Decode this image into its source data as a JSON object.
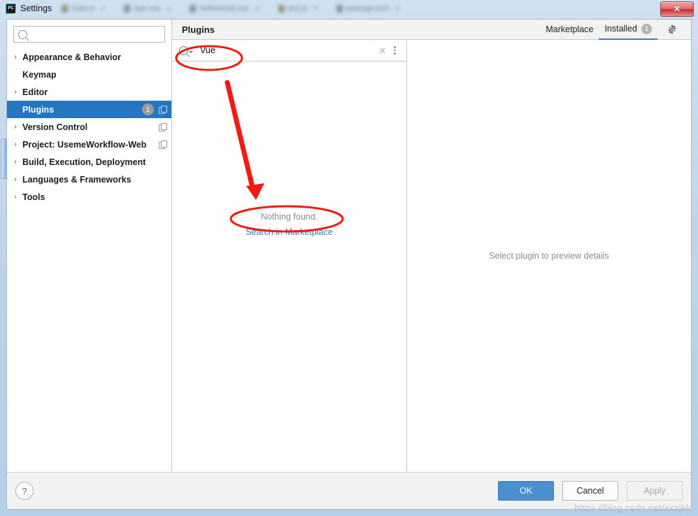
{
  "window": {
    "title": "Settings",
    "icon": "pycharm-logo-icon",
    "close_label": "✕",
    "background_tabs": [
      {
        "label": "main.js"
      },
      {
        "label": "App.vue"
      },
      {
        "label": "HelloWorld.vue"
      },
      {
        "label": "test.js"
      },
      {
        "label": "package.json"
      }
    ]
  },
  "sidebar": {
    "search": {
      "value": "",
      "placeholder": ""
    },
    "items": [
      {
        "label": "Appearance & Behavior",
        "expandable": true,
        "selected": false,
        "badge": "",
        "copy": false
      },
      {
        "label": "Keymap",
        "expandable": false,
        "selected": false,
        "badge": "",
        "copy": false
      },
      {
        "label": "Editor",
        "expandable": true,
        "selected": false,
        "badge": "",
        "copy": false
      },
      {
        "label": "Plugins",
        "expandable": false,
        "selected": true,
        "badge": "1",
        "copy": true
      },
      {
        "label": "Version Control",
        "expandable": true,
        "selected": false,
        "badge": "",
        "copy": true
      },
      {
        "label": "Project: UsemeWorkflow-Web",
        "expandable": true,
        "selected": false,
        "badge": "",
        "copy": true
      },
      {
        "label": "Build, Execution, Deployment",
        "expandable": true,
        "selected": false,
        "badge": "",
        "copy": false
      },
      {
        "label": "Languages & Frameworks",
        "expandable": true,
        "selected": false,
        "badge": "",
        "copy": false
      },
      {
        "label": "Tools",
        "expandable": true,
        "selected": false,
        "badge": "",
        "copy": false
      }
    ]
  },
  "plugins": {
    "title": "Plugins",
    "tabs": [
      {
        "label": "Marketplace",
        "active": false,
        "badge": ""
      },
      {
        "label": "Installed",
        "active": true,
        "badge": "1"
      }
    ],
    "gear_icon": "gear-icon",
    "search": {
      "value": "Vue",
      "placeholder": "",
      "clear_label": "✕"
    },
    "empty_state": {
      "message": "Nothing found.",
      "link": "Search in Marketplace"
    },
    "detail_placeholder": "Select plugin to preview details"
  },
  "footer": {
    "help_label": "?",
    "ok_label": "OK",
    "cancel_label": "Cancel",
    "apply_label": "Apply"
  },
  "watermark": "https://blog.csdn.net/xxxjkk",
  "colors": {
    "accent": "#2675bf",
    "tab_underline": "#3c7fc0",
    "link": "#3b7cbb",
    "annotation": "#ee1c12",
    "titlebar": "#b8d3ea"
  }
}
